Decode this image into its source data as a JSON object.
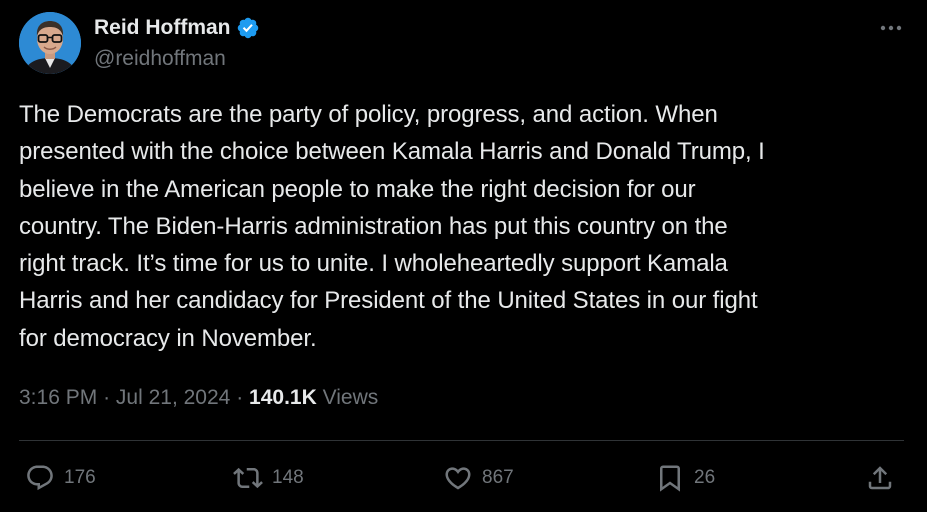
{
  "author": {
    "display_name": "Reid Hoffman",
    "handle": "@reidhoffman",
    "verified": true
  },
  "tweet": {
    "text": "The Democrats are the party of policy, progress, and action. When\npresented with the choice between Kamala Harris and Donald Trump, I\nbelieve in the American people to make the right decision for our\ncountry. The Biden-Harris administration has put this country on the\nright track. It’s time for us to unite. I wholeheartedly support Kamala\nHarris and her candidacy for President of the United States in our fight\nfor democracy in November.",
    "time": "3:16 PM",
    "separator": "·",
    "date": "Jul 21, 2024",
    "views_count": "140.1K",
    "views_label": "Views"
  },
  "actions": {
    "replies": "176",
    "reposts": "148",
    "likes": "867",
    "bookmarks": "26"
  },
  "icons": {
    "more": "more-horizontal-icon",
    "reply": "reply-icon",
    "repost": "repost-icon",
    "like": "heart-icon",
    "bookmark": "bookmark-icon",
    "share": "share-icon",
    "verified": "verified-badge-icon"
  },
  "colors": {
    "background": "#000000",
    "text_primary": "#e7e9ea",
    "text_secondary": "#71767b",
    "verified_blue": "#1d9bf0",
    "divider": "#2f3336"
  }
}
